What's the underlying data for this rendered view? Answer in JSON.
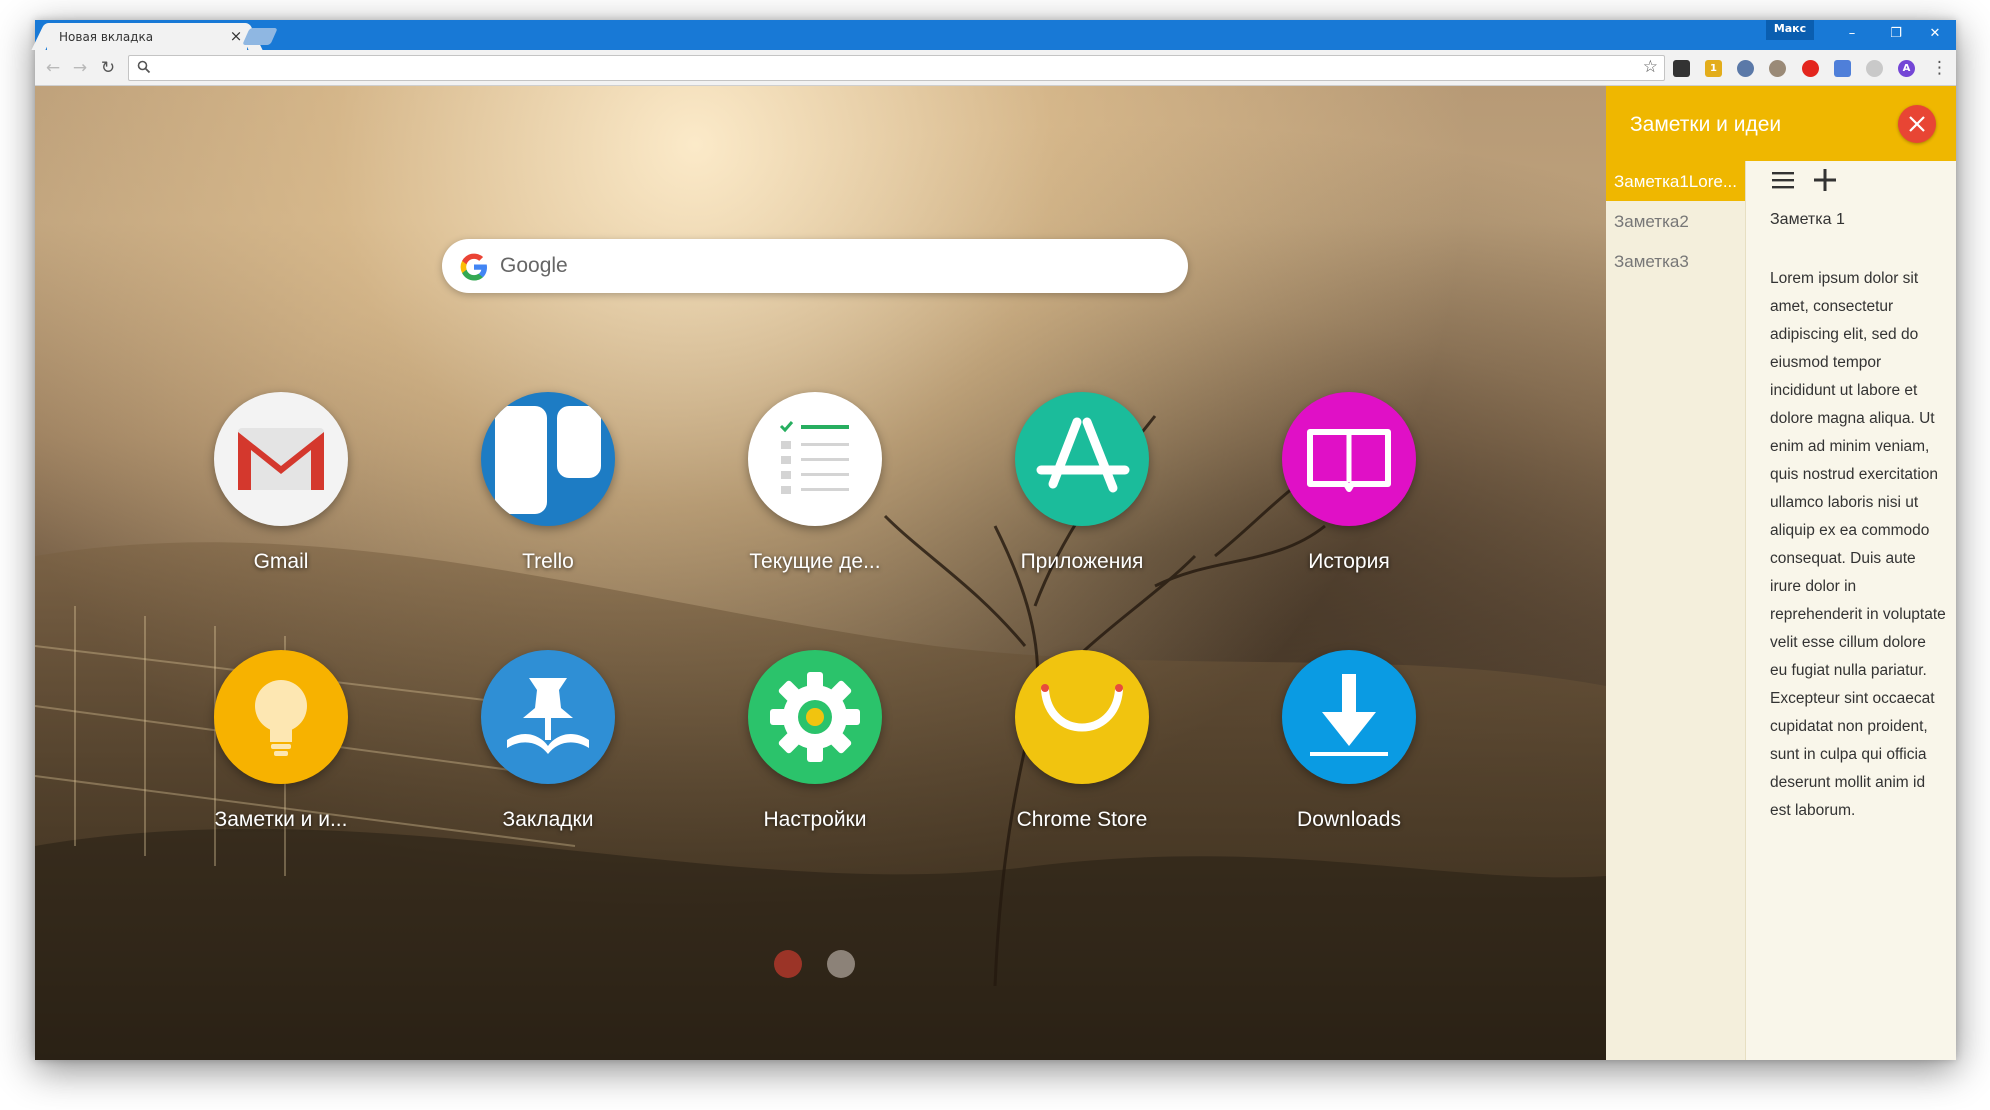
{
  "browser": {
    "tab_title": "Новая вкладка",
    "tab_close": "×",
    "profile_name": "Макс",
    "window_controls": {
      "minimize": "–",
      "restore": "❐",
      "close": "✕"
    },
    "address_value": ""
  },
  "toolbar": {
    "back": "←",
    "forward": "→",
    "reload": "↻",
    "bookmark_star": "☆",
    "menu": "⋮",
    "extension_badges": {
      "ext2": "1",
      "ext6": "A"
    },
    "extension_icons": [
      "pocket-icon",
      "notes-ext-icon",
      "owl-icon",
      "cat-icon",
      "opera-icon",
      "translate-icon",
      "gray-circle-icon",
      "vpn-a-icon"
    ]
  },
  "search": {
    "placeholder": "Google"
  },
  "apps": [
    {
      "label": "Gmail",
      "icon": "gmail-icon",
      "color": "#f3f3f3"
    },
    {
      "label": "Trello",
      "icon": "trello-icon",
      "color": "#1d7cc4"
    },
    {
      "label": "Текущие де...",
      "icon": "todo-list-icon",
      "color": "#ffffff"
    },
    {
      "label": "Приложения",
      "icon": "app-store-icon",
      "color": "#1bbc9b"
    },
    {
      "label": "История",
      "icon": "book-icon",
      "color": "#e010c6"
    },
    {
      "label": "Заметки и и...",
      "icon": "lightbulb-icon",
      "color": "#f7b200"
    },
    {
      "label": "Закладки",
      "icon": "pushpin-icon",
      "color": "#2f8fd5"
    },
    {
      "label": "Настройки",
      "icon": "gear-icon",
      "color": "#2bc36b"
    },
    {
      "label": "Chrome Store",
      "icon": "smile-bag-icon",
      "color": "#f1c40f"
    },
    {
      "label": "Downloads",
      "icon": "download-arrow-icon",
      "color": "#0a9be3"
    }
  ],
  "pagination": {
    "pages": 2,
    "active": 1,
    "active_color": "#9b3427",
    "inactive_color": "#8c8278"
  },
  "notes": {
    "title": "Заметки и идеи",
    "accent": "#efb700",
    "close_color": "#e84534",
    "items": [
      "Заметка1Lore...",
      "Заметка2",
      "Заметка3"
    ],
    "active_index": 0,
    "editor": {
      "title": "Заметка 1",
      "body": "Lorem ipsum dolor sit amet, consectetur adipiscing elit, sed do eiusmod tempor incididunt ut labore et dolore magna aliqua. Ut enim ad minim veniam, quis nostrud exercitation ullamco laboris nisi ut aliquip ex ea commodo consequat. Duis aute irure dolor in reprehenderit in voluptate velit esse cillum dolore eu fugiat nulla pariatur. Excepteur sint occaecat cupidatat non proident, sunt in culpa qui officia deserunt mollit anim id est laborum."
    }
  }
}
